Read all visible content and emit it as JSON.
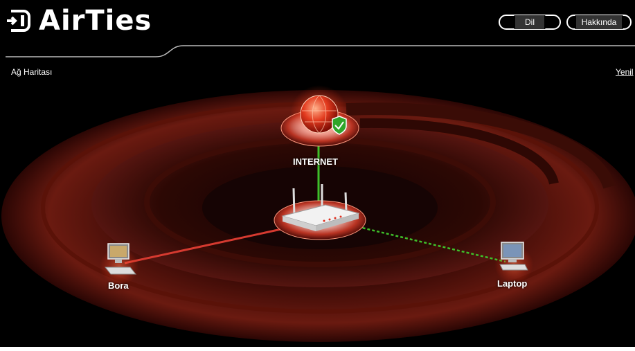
{
  "header": {
    "brand": "AirTies",
    "language_button": "Dil",
    "about_button": "Hakkında"
  },
  "page": {
    "title": "Ağ Haritası",
    "refresh_link": "Yenil"
  },
  "network_map": {
    "internet_label": "INTERNET",
    "internet_status": "connected",
    "clients": [
      {
        "name": "Bora",
        "connection": "wired"
      },
      {
        "name": "Laptop",
        "connection": "wireless"
      }
    ]
  },
  "colors": {
    "background": "#000000",
    "accent_red": "#cc2a1a",
    "link_green": "#3fbf2a",
    "wired_line": "#d63a30"
  }
}
